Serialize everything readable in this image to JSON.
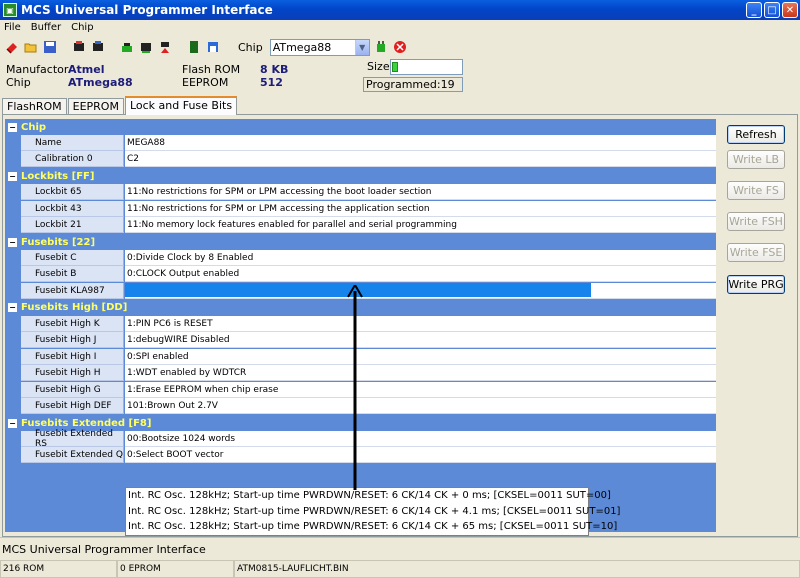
{
  "window": {
    "title": "MCS Universal Programmer Interface",
    "min": "_",
    "max": "□",
    "close": "✕"
  },
  "menu": [
    "File",
    "Buffer",
    "Chip"
  ],
  "toolbar": {
    "chip_label": "Chip",
    "chip_selected": "ATmega88"
  },
  "info": {
    "manufactor_label": "Manufactor",
    "manufactor_value": "Atmel",
    "chip_label": "Chip",
    "chip_value": "ATmega88",
    "flash_label": "Flash ROM",
    "flash_value": "8 KB",
    "eeprom_label": "EEPROM",
    "eeprom_value": "512",
    "size_label": "Size",
    "size_progress": 0.08,
    "programmed": "Programmed:19"
  },
  "tabs": [
    {
      "label": "FlashROM",
      "active": false
    },
    {
      "label": "EEPROM",
      "active": false
    },
    {
      "label": "Lock and Fuse Bits",
      "active": true
    }
  ],
  "grid": {
    "chip": {
      "header": "Chip",
      "rows": [
        {
          "name": "Name",
          "value": "MEGA88"
        },
        {
          "name": "Calibration 0",
          "value": "C2"
        }
      ]
    },
    "lockbits": {
      "header": "Lockbits [FF]",
      "rows": [
        {
          "name": "Lockbit 65",
          "value": "11:No restrictions for SPM or LPM accessing the boot loader section"
        },
        {
          "name": "Lockbit 43",
          "value": "11:No restrictions for SPM or LPM accessing the application section"
        },
        {
          "name": "Lockbit 21",
          "value": "11:No memory lock features enabled for parallel and serial programming"
        }
      ]
    },
    "fusebits": {
      "header": "Fusebits [22]",
      "rows": [
        {
          "name": "Fusebit C",
          "value": "0:Divide Clock by 8 Enabled"
        },
        {
          "name": "Fusebit B",
          "value": "0:CLOCK Output enabled"
        },
        {
          "name": "Fusebit KLA987",
          "value": ""
        }
      ]
    },
    "fusebits_high": {
      "header": "Fusebits High [DD]",
      "rows": [
        {
          "name": "Fusebit High K",
          "value": "1:PIN PC6 is RESET"
        },
        {
          "name": "Fusebit High J",
          "value": "1:debugWIRE Disabled"
        },
        {
          "name": "Fusebit High I",
          "value": "0:SPI enabled"
        },
        {
          "name": "Fusebit High H",
          "value": "1:WDT enabled by WDTCR"
        },
        {
          "name": "Fusebit High G",
          "value": "1:Erase EEPROM when chip erase"
        },
        {
          "name": "Fusebit High DEF",
          "value": "101:Brown Out 2.7V"
        }
      ]
    },
    "fusebits_ext": {
      "header": "Fusebits Extended [F8]",
      "rows": [
        {
          "name": "Fusebit Extended RS",
          "value": "00:Bootsize 1024 words"
        },
        {
          "name": "Fusebit Extended Q",
          "value": "0:Select BOOT vector"
        }
      ]
    }
  },
  "dropdown_options": [
    "Int. RC Osc. 128kHz; Start-up time PWRDWN/RESET: 6 CK/14 CK + 0 ms; [CKSEL=0011 SUT=00]",
    "Int. RC Osc. 128kHz; Start-up time PWRDWN/RESET: 6 CK/14 CK + 4.1 ms; [CKSEL=0011 SUT=01]",
    "Int. RC Osc. 128kHz; Start-up time PWRDWN/RESET: 6 CK/14 CK + 65 ms; [CKSEL=0011 SUT=10]"
  ],
  "buttons": {
    "refresh": "Refresh",
    "write_lb": "Write LB",
    "write_fs": "Write FS",
    "write_fsh": "Write FSH",
    "write_fse": "Write FSE",
    "write_prg": "Write PRG"
  },
  "status_title": "MCS Universal Programmer Interface",
  "statusbar": {
    "rom": "216 ROM",
    "eprom": "0 EPROM",
    "file": "ATM0815-LAUFLICHT.BIN"
  },
  "colors": {
    "grid_bg": "#5d8ad6",
    "category_text": "#ffff62",
    "selected_bar": "#1784eb",
    "title_blue": "#0a5fe0"
  }
}
